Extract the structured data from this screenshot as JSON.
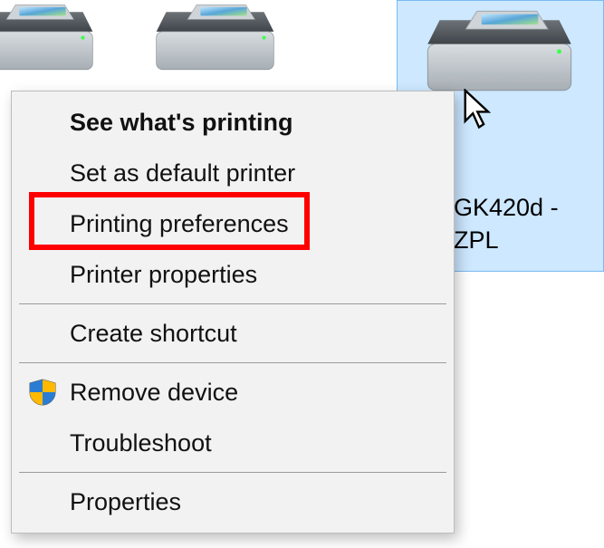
{
  "selected_printer": {
    "label_line1": "GK420d -",
    "label_line2": "ZPL"
  },
  "context_menu": {
    "items": [
      {
        "label": "See what's printing",
        "bold": true
      },
      {
        "label": "Set as default printer",
        "bold": false
      },
      {
        "label": "Printing preferences",
        "bold": false,
        "highlighted": true
      },
      {
        "label": "Printer properties",
        "bold": false
      },
      {
        "sep": true
      },
      {
        "label": "Create shortcut",
        "bold": false
      },
      {
        "sep": true
      },
      {
        "label": "Remove device",
        "bold": false,
        "shield": true
      },
      {
        "label": "Troubleshoot",
        "bold": false
      },
      {
        "sep": true
      },
      {
        "label": "Properties",
        "bold": false
      }
    ]
  }
}
